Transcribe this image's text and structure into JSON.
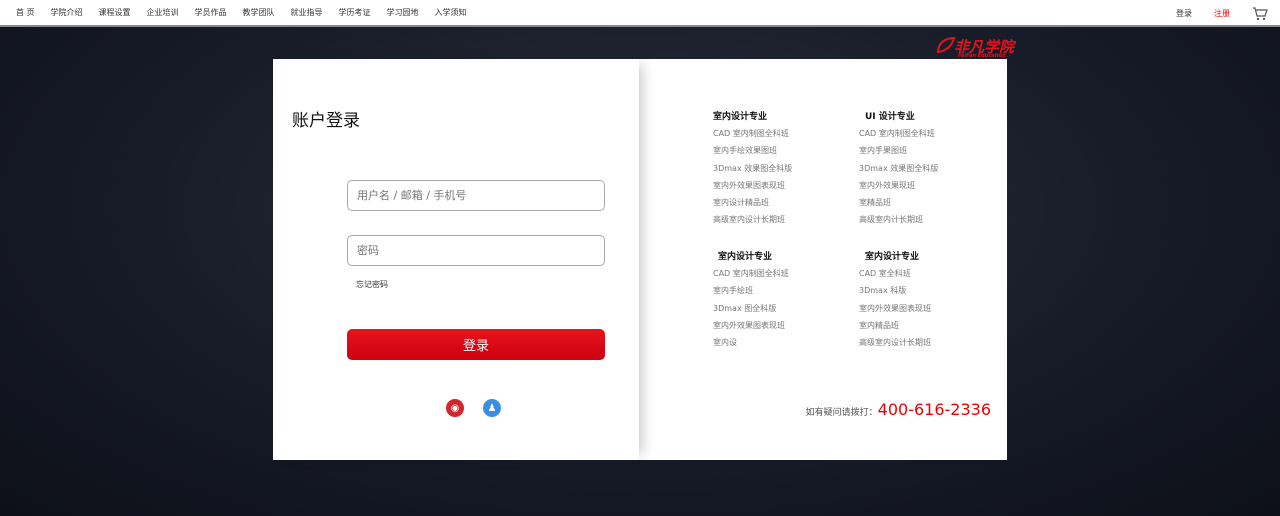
{
  "nav": [
    "首 页",
    "学院介绍",
    "课程设置",
    "企业培训",
    "学员作品",
    "教学团队",
    "就业指导",
    "学历考证",
    "学习园地",
    "入学须知"
  ],
  "top_right": {
    "login": "登录",
    "register": "注册",
    "cart_icon": "cart-icon"
  },
  "logo": {
    "text": "非凡学院",
    "sub": "FeiFan Education"
  },
  "login": {
    "title": "账户登录",
    "username_placeholder": "用户名 / 邮箱 / 手机号",
    "password_placeholder": "密码",
    "forgot": "忘记密码",
    "submit": "登录",
    "social": [
      "weibo-icon",
      "qq-icon"
    ]
  },
  "courses": [
    {
      "title": "室内设计专业",
      "items": [
        "CAD 室内制图全科班",
        "室内手绘效果图班",
        "3Dmax 效果图全科版",
        "室内外效果图表现班",
        "室内设计精品班",
        "高级室内设计长期班"
      ]
    },
    {
      "title": "UI 设计专业",
      "items": [
        "CAD 室内制图全科班",
        "室内手果图班",
        "3Dmax 效果图全科版",
        "室内外效果现班",
        "室精品班",
        "高级室内计长期班"
      ]
    },
    {
      "title": "室内设计专业",
      "items": [
        "CAD 室内制图全科班",
        "室内手绘班",
        "3Dmax 图全科版",
        "室内外效果图表现班",
        "室内设"
      ]
    },
    {
      "title": "室内设计专业",
      "items": [
        "CAD 室全科班",
        "3Dmax 科版",
        "室内外效果图表现班",
        "室内精品班",
        "高级室内设计长期班"
      ]
    }
  ],
  "contact": {
    "label": "如有疑问请拨打：",
    "phone": "400-616-2336"
  }
}
